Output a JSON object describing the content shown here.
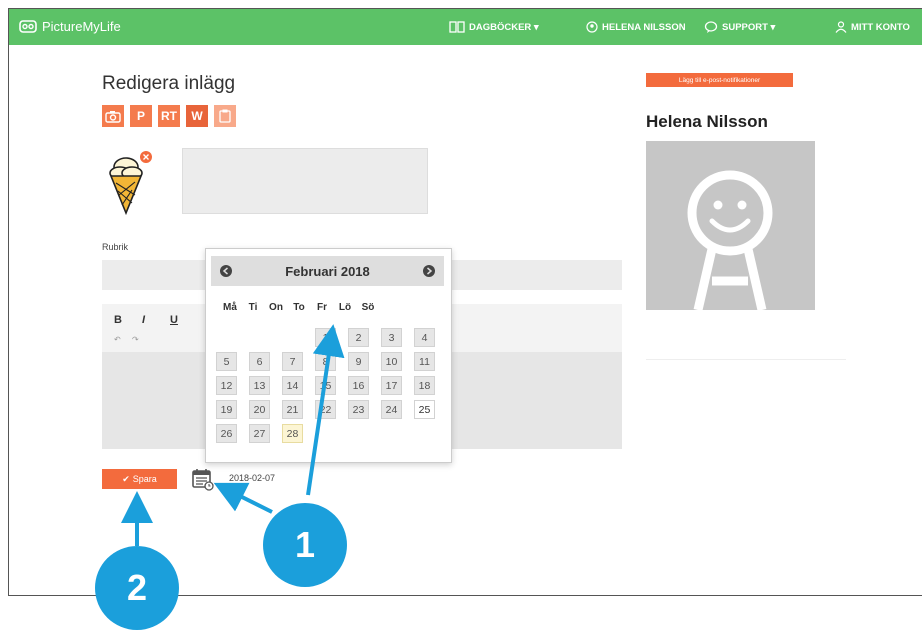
{
  "topbar": {
    "logo": "PictureMyLife",
    "nav_diaries": "DAGBÖCKER ▾",
    "nav_user": "HELENA NILSSON",
    "nav_support": "SUPPORT ▾",
    "nav_account": "MITT KONTO"
  },
  "editor": {
    "title": "Redigera inlägg",
    "toolbar": [
      "",
      "P",
      "RT",
      "W",
      ""
    ],
    "heading_label": "Rubrik",
    "format_buttons": [
      "B",
      "I",
      "U"
    ],
    "undo_redo": [
      "↶",
      "↷"
    ]
  },
  "calendar": {
    "month_title": "Februari 2018",
    "weekdays": [
      "Må",
      "Ti",
      "On",
      "To",
      "Fr",
      "Lö",
      "Sö"
    ],
    "first_weekday_index": 3,
    "days_in_month": 28,
    "today": 25,
    "selected": 28
  },
  "footer": {
    "save_label": "Spara",
    "date_value": "2018-02-07"
  },
  "sidebar": {
    "notify_button": "Lägg till e-post-notifikationer",
    "profile_name": "Helena Nilsson"
  },
  "callouts": {
    "one": "1",
    "two": "2"
  },
  "colors": {
    "brand_green": "#5cc267",
    "accent_orange": "#f36b3d",
    "callout_blue": "#1b9fdb"
  }
}
